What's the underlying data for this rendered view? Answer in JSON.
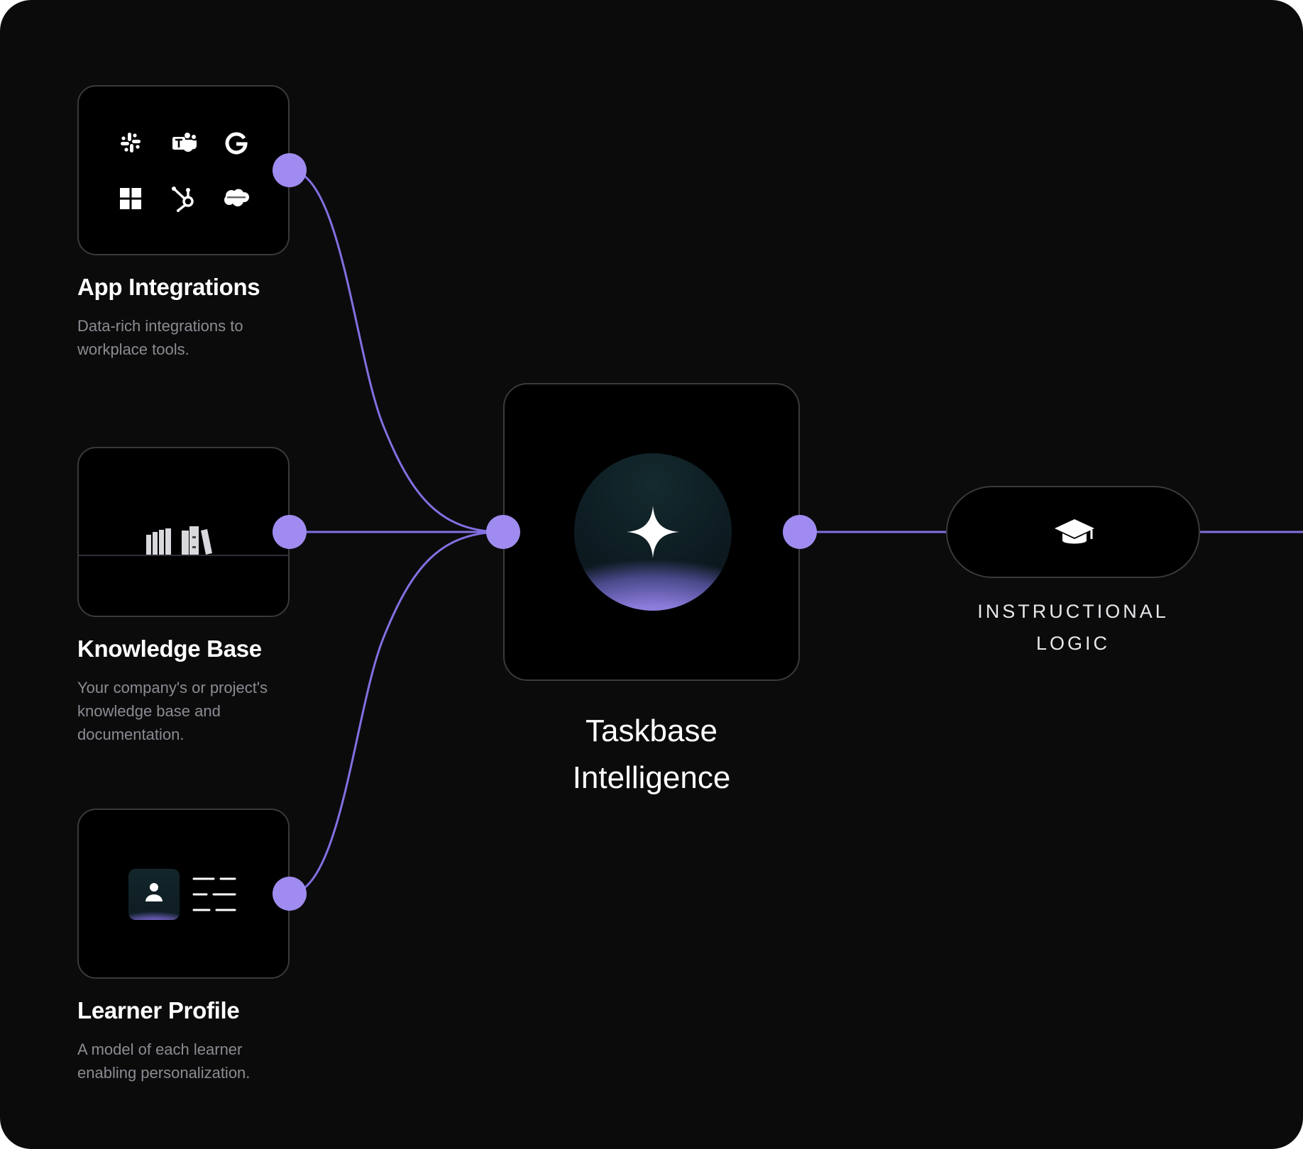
{
  "colors": {
    "background": "#0b0b0c",
    "card": "#000000",
    "card_border": "#3a3a3e",
    "accent": "#a08cf0",
    "wire": "#8270e0",
    "title_text": "#ffffff",
    "description_text": "#8b8b92"
  },
  "sources": [
    {
      "title": "App Integrations",
      "description": "Data-rich integrations to workplace tools.",
      "icons": [
        "slack-icon",
        "teams-icon",
        "google-icon",
        "windows-icon",
        "hubspot-icon",
        "salesforce-icon"
      ]
    },
    {
      "title": "Knowledge Base",
      "description": "Your company's or project's knowledge base and documentation.",
      "icons": [
        "books-icon"
      ]
    },
    {
      "title": "Learner Profile",
      "description": "A model of each learner enabling personalization.",
      "icons": [
        "user-icon",
        "profile-lines-icon"
      ]
    }
  ],
  "center": {
    "title_line1": "Taskbase",
    "title_line2": "Intelligence",
    "icon": "sparkle-icon"
  },
  "output": {
    "label_line1": "INSTRUCTIONAL",
    "label_line2": "LOGIC",
    "icon": "graduation-cap-icon"
  }
}
